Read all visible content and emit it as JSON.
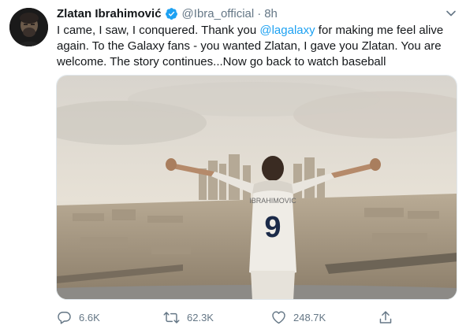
{
  "tweet": {
    "author_name": "Zlatan Ibrahimović",
    "handle": "@Ibra_official",
    "separator": "·",
    "time": "8h",
    "text_part1": "I came, I saw, I conquered. Thank you ",
    "mention": "@lagalaxy",
    "text_part2": " for making me feel alive again. To the Galaxy fans -  you wanted Zlatan, I gave you Zlatan. You are welcome. The story continues...Now go back to watch baseball",
    "jersey_name": "IBRAHIMOVIC",
    "jersey_number": "9"
  },
  "actions": {
    "reply_count": "6.6K",
    "retweet_count": "62.3K",
    "like_count": "248.7K"
  },
  "icons": {
    "verified": "verified-badge-icon",
    "caret": "chevron-down-icon",
    "reply": "reply-icon",
    "retweet": "retweet-icon",
    "like": "heart-icon",
    "share": "share-icon"
  },
  "colors": {
    "link": "#1da1f2",
    "secondary_text": "#657786",
    "primary_text": "#14171a",
    "verified": "#1da1f2"
  }
}
